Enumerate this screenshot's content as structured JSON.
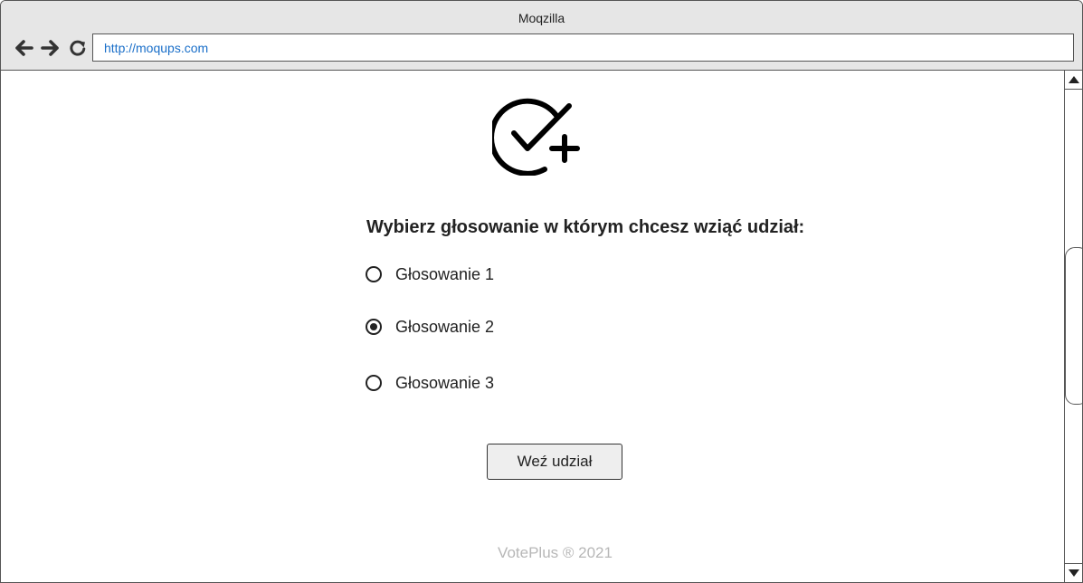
{
  "browser": {
    "title": "Moqzilla",
    "url": "http://moqups.com",
    "nav_icons": [
      "back-arrow-icon",
      "forward-arrow-icon",
      "reload-icon"
    ]
  },
  "page": {
    "logo_icon": "check-circle-plus-icon",
    "question": "Wybierz głosowanie w którym chcesz wziąć udział:",
    "options": [
      {
        "label": "Głosowanie 1",
        "selected": false
      },
      {
        "label": "Głosowanie 2",
        "selected": true
      },
      {
        "label": "Głosowanie 3",
        "selected": false
      }
    ],
    "submit_label": "Weź udział",
    "footer": "VotePlus ® 2021"
  },
  "colors": {
    "chrome_bg": "#e6e6e6",
    "url_text": "#1a6fc9",
    "footer_text": "#b7b7b7",
    "button_bg": "#eeeeee"
  }
}
